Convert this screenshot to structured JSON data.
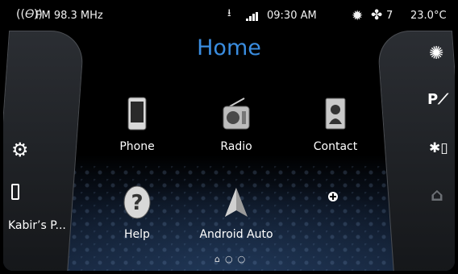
{
  "status": {
    "radio": "FM 98.3 MHz",
    "time": "09:30 AM",
    "fan_speed": "7",
    "temperature": "23.0°C",
    "icons": [
      "radio-signal-icon",
      "usb-icon",
      "signal-bars-icon",
      "ac-icon",
      "fan-icon"
    ]
  },
  "title": "Home",
  "apps": [
    {
      "label": "Phone",
      "icon": "phone-icon"
    },
    {
      "label": "Radio",
      "icon": "radio-icon"
    },
    {
      "label": "Contact",
      "icon": "contact-icon"
    },
    {
      "label": "Help",
      "icon": "help-icon"
    },
    {
      "label": "Android Auto",
      "icon": "android-auto-icon"
    },
    {
      "label": "",
      "icon": "add-icon"
    }
  ],
  "left_panel": {
    "device_name": "Kabir’s P..."
  },
  "right_panel": {
    "icons": [
      "climate-icon",
      "park-assist-icon",
      "bluetooth-battery-icon",
      "home-icon"
    ]
  },
  "pager": {
    "pages": 3,
    "active": 0
  },
  "colors": {
    "title": "#3a8de0",
    "background": "#000000"
  }
}
